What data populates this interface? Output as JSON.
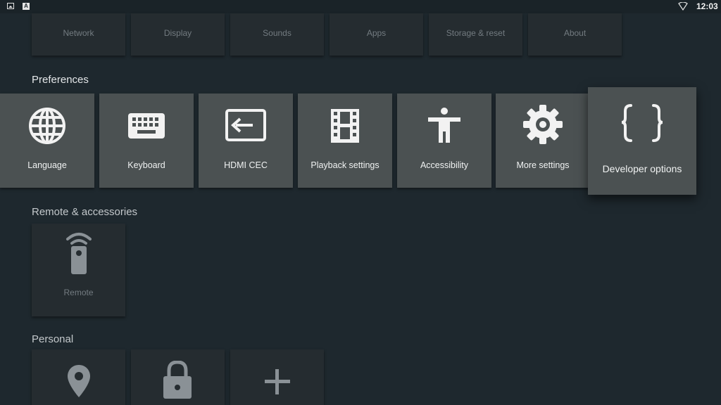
{
  "status_bar": {
    "time": "12:03"
  },
  "top_row": [
    {
      "label": "Network"
    },
    {
      "label": "Display"
    },
    {
      "label": "Sounds"
    },
    {
      "label": "Apps"
    },
    {
      "label": "Storage & reset"
    },
    {
      "label": "About"
    }
  ],
  "preferences": {
    "title": "Preferences",
    "items": [
      {
        "label": "Language",
        "icon": "globe-icon"
      },
      {
        "label": "Keyboard",
        "icon": "keyboard-icon"
      },
      {
        "label": "HDMI CEC",
        "icon": "hdmi-input-icon"
      },
      {
        "label": "Playback settings",
        "icon": "film-icon"
      },
      {
        "label": "Accessibility",
        "icon": "accessibility-icon"
      },
      {
        "label": "More settings",
        "icon": "gear-icon"
      },
      {
        "label": "Developer options",
        "icon": "braces-icon",
        "focused": true
      }
    ]
  },
  "remote": {
    "title": "Remote & accessories",
    "items": [
      {
        "label": "Remote",
        "icon": "remote-icon"
      }
    ]
  },
  "personal": {
    "title": "Personal",
    "items": [
      {
        "icon": "location-pin-icon"
      },
      {
        "icon": "lock-icon"
      },
      {
        "icon": "plus-icon"
      }
    ]
  }
}
